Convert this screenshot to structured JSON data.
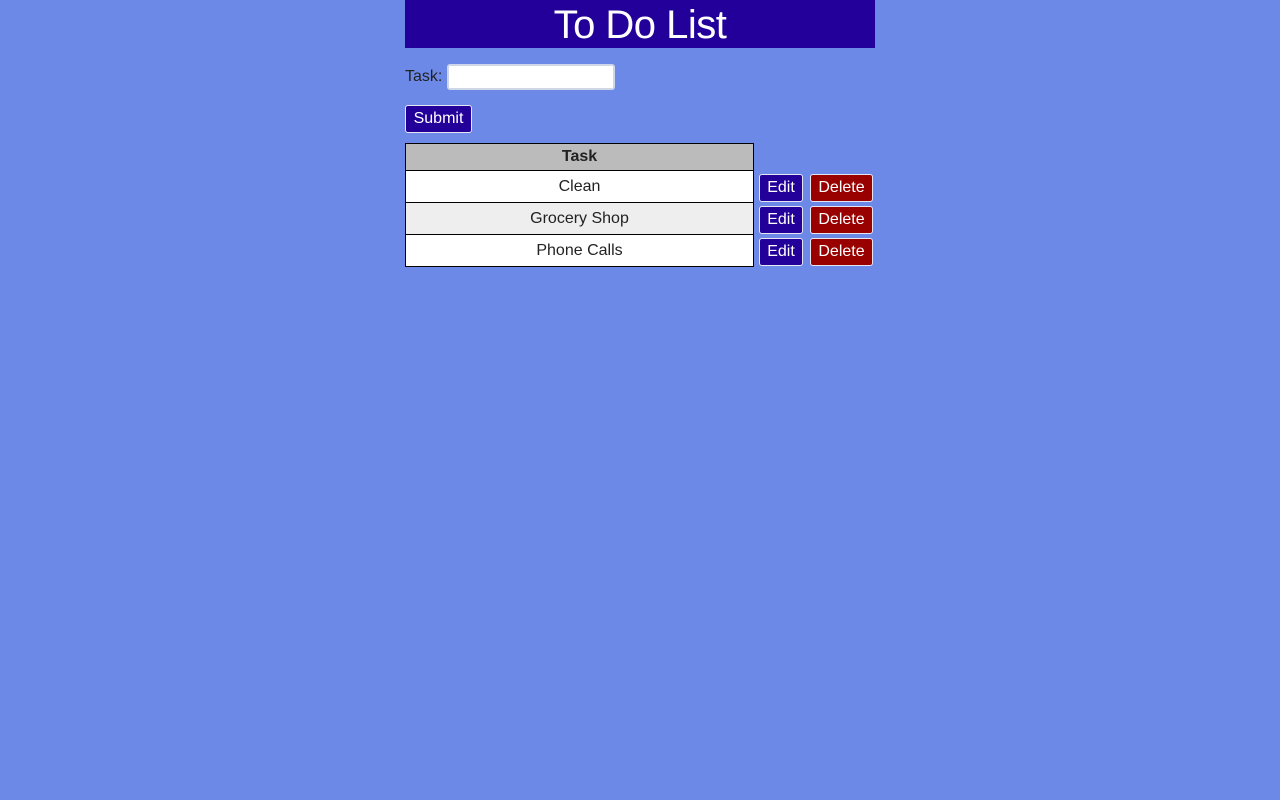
{
  "header": {
    "title": "To Do List"
  },
  "form": {
    "task_label": "Task:",
    "task_value": "",
    "task_placeholder": "",
    "submit_label": "Submit"
  },
  "table": {
    "column_header": "Task",
    "rows": [
      {
        "task": "Clean",
        "edit_label": "Edit",
        "delete_label": "Delete"
      },
      {
        "task": "Grocery Shop",
        "edit_label": "Edit",
        "delete_label": "Delete"
      },
      {
        "task": "Phone Calls",
        "edit_label": "Edit",
        "delete_label": "Delete"
      }
    ]
  },
  "colors": {
    "background": "#6d89e8",
    "header_bg": "#220099",
    "edit_button": "#220099",
    "delete_button": "#990000",
    "table_header_bg": "#bbbbbb",
    "row_alt_bg": "#eeeeee"
  }
}
